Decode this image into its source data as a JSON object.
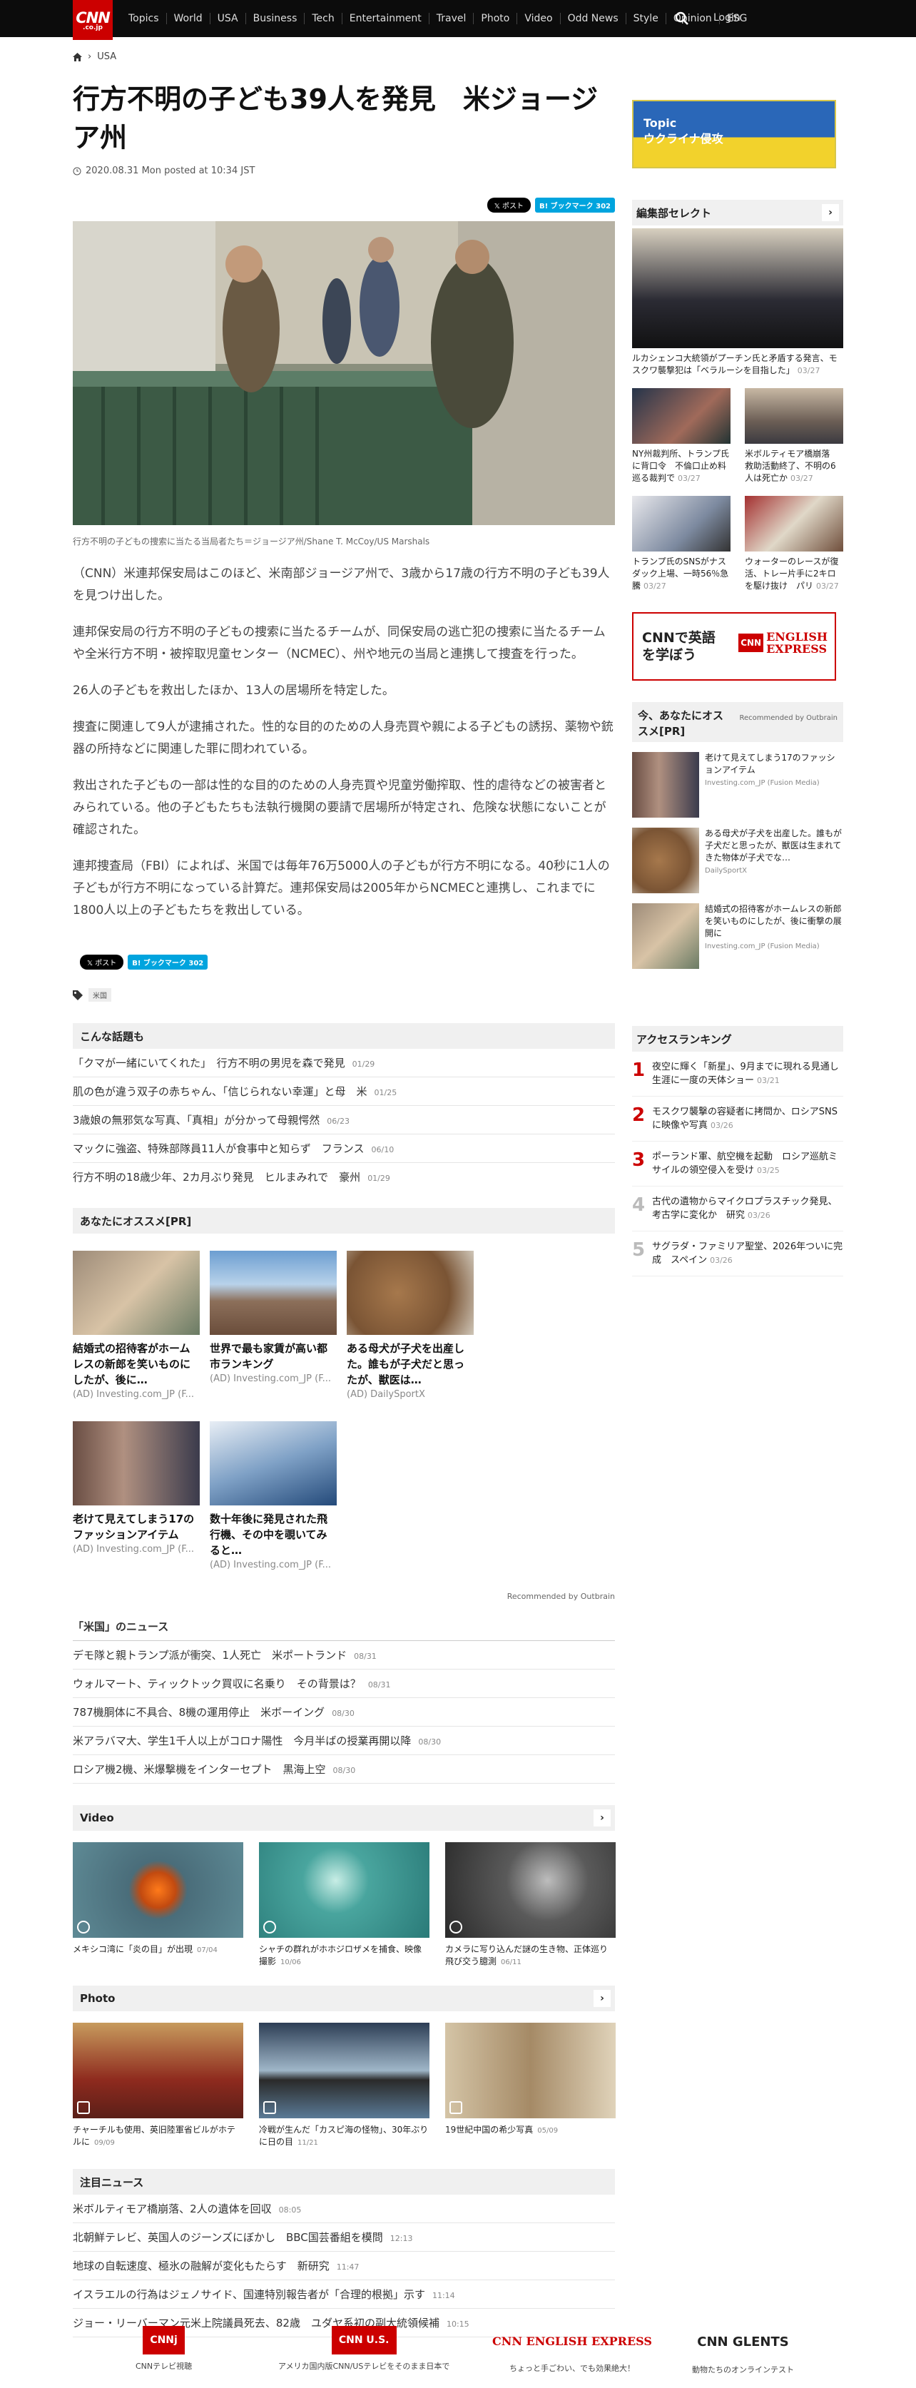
{
  "header": {
    "logo_text": "CNN",
    "logo_sub": ".co.jp",
    "nav": [
      "Topics",
      "World",
      "USA",
      "Business",
      "Tech",
      "Entertainment",
      "Travel",
      "Photo",
      "Video",
      "Odd News",
      "Style",
      "Opinion",
      "ESG"
    ],
    "login": "Login"
  },
  "breadcrumb": {
    "section": "USA"
  },
  "article": {
    "title": "行方不明の子ども39人を発見　米ジョージア州",
    "date": "2020.08.31 Mon posted at 10:34 JST",
    "share_x": "𝕏 ポスト",
    "share_hatena": "B! ブックマーク 302",
    "caption": "行方不明の子どもの捜索に当たる当局者たち＝ジョージア州/Shane T. McCoy/US Marshals",
    "paragraphs": [
      "（CNN）米連邦保安局はこのほど、米南部ジョージア州で、3歳から17歳の行方不明の子ども39人を見つけ出した。",
      "連邦保安局の行方不明の子どもの捜索に当たるチームが、同保安局の逃亡犯の捜索に当たるチームや全米行方不明・被搾取児童センター（NCMEC）、州や地元の当局と連携して捜査を行った。",
      "26人の子どもを救出したほか、13人の居場所を特定した。",
      "捜査に関連して9人が逮捕された。性的な目的のための人身売買や親による子どもの誘拐、薬物や銃器の所持などに関連した罪に問われている。",
      "救出された子どもの一部は性的な目的のための人身売買や児童労働搾取、性的虐待などの被害者とみられている。他の子どもたちも法執行機関の要請で居場所が特定され、危険な状態にないことが確認された。",
      "連邦捜査局（FBI）によれば、米国では毎年76万5000人の子どもが行方不明になる。40秒に1人の子どもが行方不明になっている計算だ。連邦保安局は2005年からNCMECと連携し、これまでに1800人以上の子どもたちを救出している。"
    ],
    "tag": "米国"
  },
  "related": {
    "heading": "こんな話題も",
    "items": [
      {
        "text": "「クマが一緒にいてくれた」　行方不明の男児を森で発見",
        "date": "01/29"
      },
      {
        "text": "肌の色が違う双子の赤ちゃん、「信じられない幸運」と母　米",
        "date": "01/25"
      },
      {
        "text": "3歳娘の無邪気な写真、「真相」が分かって母親愕然",
        "date": "06/23"
      },
      {
        "text": "マックに強盗、特殊部隊員11人が食事中と知らず　フランス",
        "date": "06/10"
      },
      {
        "text": "行方不明の18歳少年、2カ月ぶり発見　ヒルまみれで　豪州",
        "date": "01/29"
      }
    ]
  },
  "recommended": {
    "heading": "あなたにオススメ[PR]",
    "items": [
      {
        "title": "結婚式の招待客がホームレスの新郎を笑いものにしたが、後に…",
        "source": "(AD) Investing.com_JP (F..."
      },
      {
        "title": "世界で最も家賃が高い都市ランキング",
        "source": "(AD) Investing.com_JP (F..."
      },
      {
        "title": "ある母犬が子犬を出産した。誰もが子犬だと思ったが、獣医は…",
        "source": "(AD) DailySportX"
      },
      {
        "title": "老けて見えてしまう17のファッションアイテム",
        "source": "(AD) Investing.com_JP (F..."
      },
      {
        "title": "数十年後に発見された飛行機、その中を覗いてみると…",
        "source": "(AD) Investing.com_JP (F..."
      }
    ],
    "powered": "Recommended by Outbrain"
  },
  "us_news": {
    "heading": "「米国」のニュース",
    "items": [
      {
        "text": "デモ隊と親トランプ派が衝突、1人死亡　米ポートランド",
        "date": "08/31"
      },
      {
        "text": "ウォルマート、ティックトック買収に名乗り　その背景は？",
        "date": "08/31"
      },
      {
        "text": "787機胴体に不具合、8機の運用停止　米ボーイング",
        "date": "08/30"
      },
      {
        "text": "米アラバマ大、学生1千人以上がコロナ陽性　今月半ばの授業再開以降",
        "date": "08/30"
      },
      {
        "text": "ロシア機2機、米爆撃機をインターセプト　黒海上空",
        "date": "08/30"
      }
    ]
  },
  "video": {
    "heading": "Video",
    "items": [
      {
        "title": "メキシコ湾に「炎の目」が出現",
        "date": "07/04"
      },
      {
        "title": "シャチの群れがホホジロザメを捕食、映像撮影",
        "date": "10/06"
      },
      {
        "title": "カメラに写り込んだ謎の生き物、正体巡り飛び交う臆測",
        "date": "06/11"
      }
    ]
  },
  "photo": {
    "heading": "Photo",
    "items": [
      {
        "title": "チャーチルも使用、英旧陸軍省ビルがホテルに",
        "date": "09/09"
      },
      {
        "title": "冷戦が生んだ「カスピ海の怪物」、30年ぶりに日の目",
        "date": "11/21"
      },
      {
        "title": "19世紀中国の希少写真",
        "date": "05/09"
      }
    ]
  },
  "featured": {
    "heading": "注目ニュース",
    "items": [
      {
        "text": "米ボルティモア橋崩落、2人の遺体を回収",
        "date": "08:05"
      },
      {
        "text": "北朝鮮テレビ、英国人のジーンズにぼかし　BBC国芸番組を模問",
        "date": "12:13"
      },
      {
        "text": "地球の自転速度、極氷の融解が変化もたらす　新研究",
        "date": "11:47"
      },
      {
        "text": "イスラエルの行為はジェノサイド、国連特別報告者が「合理的根拠」示す",
        "date": "11:14"
      },
      {
        "text": "ジョー・リーバーマン元米上院議員死去、82歳　ユダヤ系初の副大統領候補",
        "date": "10:15"
      }
    ]
  },
  "sidebar": {
    "banner_topic": "Topic",
    "banner_label": "ウクライナ侵攻",
    "editor_heading": "編集部セレクト",
    "editor_big": {
      "title": "ルカシェンコ大統領がプーチン氏と矛盾する発言、モスクワ襲撃犯は「ベラルーシを目指した」",
      "date": "03/27"
    },
    "editor_small": [
      {
        "title": "NY州裁判所、トランプ氏に背口令　不倫口止め料巡る裁判で",
        "date": "03/27"
      },
      {
        "title": "米ボルティモア橋崩落　救助活動終了、不明の6人は死亡か",
        "date": "03/27"
      },
      {
        "title": "トランプ氏のSNSがナスダック上場、一時56％急騰",
        "date": "03/27"
      },
      {
        "title": "ウォーターのレースが復活、トレー片手に2キロを駆け抜け　パリ",
        "date": "03/27"
      }
    ],
    "promo_text": "CNNで英語を学ぼう",
    "promo_brand1": "ENGLISH",
    "promo_brand2": "EXPRESS",
    "pr_heading": "今、あなたにオススメ[PR]",
    "pr_powered": "Recommended by Outbrain",
    "pr_items": [
      {
        "title": "老けて見えてしまう17のファッションアイテム",
        "source": "Investing.com_JP (Fusion Media)"
      },
      {
        "title": "ある母犬が子犬を出産した。誰もが子犬だと思ったが、獣医は生まれてきた物体が子犬でな…",
        "source": "DailySportX"
      },
      {
        "title": "結婚式の招待客がホームレスの新郎を笑いものにしたが、後に衝撃の展開に",
        "source": "Investing.com_JP (Fusion Media)"
      }
    ],
    "ranking_heading": "アクセスランキング",
    "ranking": [
      {
        "n": "1",
        "title": "夜空に輝く「新星」、9月までに現れる見通し　生涯に一度の天体ショー",
        "date": "03/21"
      },
      {
        "n": "2",
        "title": "モスクワ襲撃の容疑者に拷問か、ロシアSNSに映像や写真",
        "date": "03/26"
      },
      {
        "n": "3",
        "title": "ポーランド軍、航空機を起動　ロシア巡航ミサイルの領空侵入を受け",
        "date": "03/25"
      },
      {
        "n": "4",
        "title": "古代の遺物からマイクロプラスチック発見、考古学に変化か　研究",
        "date": "03/26"
      },
      {
        "n": "5",
        "title": "サグラダ・ファミリア聖堂、2026年ついに完成　スペイン",
        "date": "03/26"
      }
    ]
  },
  "footer": {
    "items": [
      {
        "brand": "CNNj",
        "label": "CNNテレビ視聴"
      },
      {
        "brand": "CNN U.S.",
        "label": "アメリカ国内版CNN/USテレビをそのまま日本で"
      },
      {
        "brand": "CNN ENGLISH EXPRESS",
        "label": "ちょっと手ごわい、でも効果絶大！"
      },
      {
        "brand": "CNN GLENTS",
        "label": "動物たちのオンラインテスト"
      }
    ]
  },
  "colors": {
    "brand_red": "#cc0000",
    "header_bg": "#0c0c0c",
    "hatena": "#00a4de"
  }
}
